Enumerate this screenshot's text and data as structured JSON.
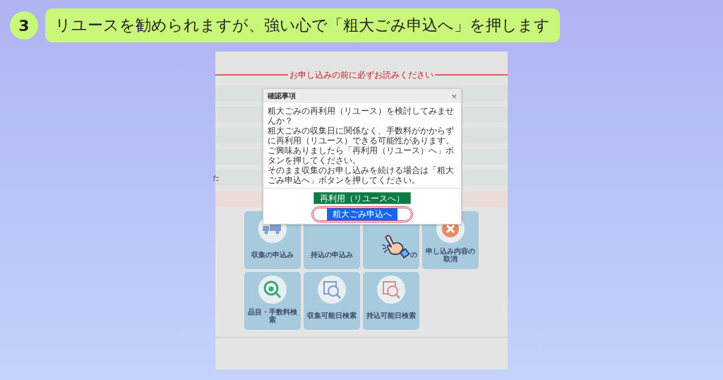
{
  "step": {
    "number": "3",
    "caption": "リユースを勧められますが、強い心で「粗大ごみ申込へ」を押します"
  },
  "page": {
    "notice": "お申し込みの前に必ずお読みください",
    "rows": [
      {
        "kind": "plain"
      },
      {
        "kind": "plain"
      },
      {
        "kind": "plain"
      },
      {
        "kind": "plain"
      },
      {
        "kind": "plain",
        "text": "た"
      },
      {
        "kind": "alert"
      }
    ],
    "tiles": [
      {
        "label": "収集の申込み"
      },
      {
        "label": "持込の申込み"
      },
      {
        "label": "の"
      },
      {
        "label": "申し込み内容の取消"
      },
      {
        "label": "品目・手数料検索"
      },
      {
        "label": "収集可能日検索"
      },
      {
        "label": "持込可能日検索"
      }
    ]
  },
  "dialog": {
    "title": "確認事項",
    "close": "×",
    "paragraphs": [
      "粗大ごみの再利用（リユース）を検討してみませんか？",
      "粗大ごみの収集日に関係なく、手数料がかからずに再利用（リユース）できる可能性があります。",
      "ご興味ありましたら「再利用（リユース）へ」ボタンを押してください。",
      "そのまま収集のお申し込みを続ける場合は「粗大ごみ申込へ」ボタンを押してください。"
    ],
    "buttons": [
      {
        "label": "再利用（リユースへ）",
        "kind": "reuse",
        "highlighted": false
      },
      {
        "label": "粗大ごみ申込へ",
        "kind": "apply",
        "highlighted": true
      }
    ]
  }
}
